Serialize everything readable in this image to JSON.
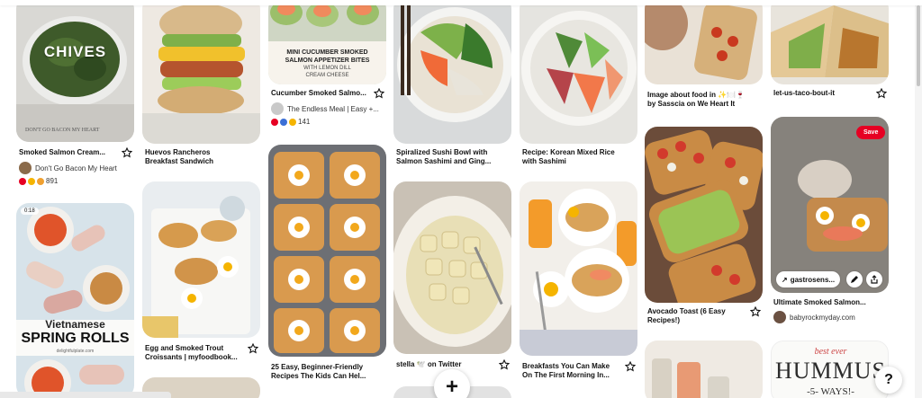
{
  "pins": {
    "chives": {
      "title": "Smoked Salmon Cream...",
      "overlay": "CHIVES",
      "author": "Don't Go Bacon My Heart",
      "count": "891"
    },
    "huevos": {
      "title_line1": "Huevos Rancheros",
      "title_line2": "Breakfast Sandwich"
    },
    "cucumber": {
      "overlay_line1": "MINI CUCUMBER SMOKED",
      "overlay_line2": "SALMON APPETIZER BITES",
      "overlay_line3": "WITH LEMON DILL",
      "overlay_line4": "CREAM CHEESE",
      "title": "Cucumber Smoked Salmo...",
      "author": "The Endless Meal | Easy +...",
      "count": "141"
    },
    "sushi": {
      "title_line1": "Spiralized Sushi Bowl with",
      "title_line2": "Salmon Sashimi and Ging..."
    },
    "korean": {
      "title_line1": "Recipe: Korean Mixed Rice",
      "title_line2": "with Sashimi"
    },
    "heart": {
      "title_line1": "Image about food in ✨🍽️🍷",
      "title_line2": "by Sasscia on We Heart It"
    },
    "taco": {
      "title": "let-us-taco-bout-it"
    },
    "spring": {
      "badge": "0:18",
      "overlay_line1": "Vietnamese",
      "overlay_line2": "SPRING ROLLS",
      "small": "delightfulplate.com"
    },
    "trout": {
      "title_line1": "Egg and Smoked Trout",
      "title_line2": "Croissants | myfoodbook..."
    },
    "toast": {
      "title_line1": "25 Easy, Beginner-Friendly",
      "title_line2": "Recipes The Kids Can Hel..."
    },
    "ravioli": {
      "title": "stella 🕊️ on Twitter"
    },
    "breakfast": {
      "title_line1": "Breakfasts You Can Make",
      "title_line2": "On The First Morning In..."
    },
    "avocado": {
      "title_line1": "Avocado Toast (6 Easy",
      "title_line2": "Recipes!)"
    },
    "ultimate": {
      "save": "Save",
      "link": "gastrosens...",
      "title": "Ultimate Smoked Salmon...",
      "author": "babyrockmyday.com"
    },
    "hummus": {
      "line1": "best ever",
      "line2": "HUMMUS",
      "line3": "-5- WAYS!-"
    }
  },
  "controls": {
    "plus": "+",
    "help": "?"
  },
  "colors": {
    "accent": "#e60023"
  }
}
